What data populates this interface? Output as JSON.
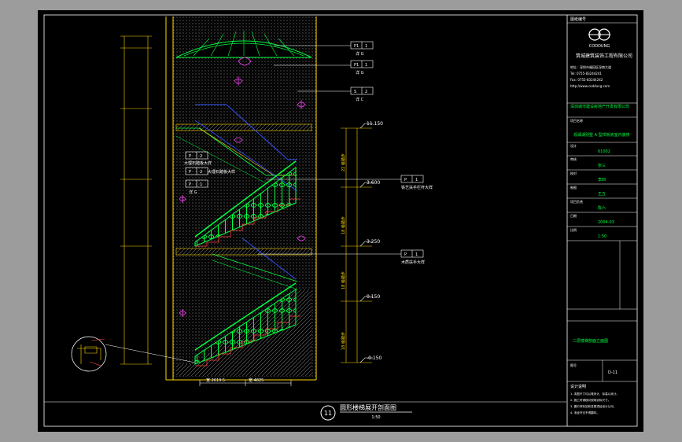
{
  "drawing_title": "圆形楼梯展开剖面图",
  "drawing_scale": "1:50",
  "detail_number": "11",
  "detail_tags": [
    {
      "number": "P1",
      "sheet": "1",
      "label": "详 G"
    },
    {
      "number": "P1",
      "sheet": "1",
      "label": "详 G"
    },
    {
      "number": "S",
      "sheet": "2",
      "label": "详 C"
    },
    {
      "number": "P",
      "sheet": "2",
      "label": "大理石踏板大样"
    },
    {
      "number": "P",
      "sheet": "2",
      "label": "大理石踏板大样"
    },
    {
      "number": "P",
      "sheet": "1",
      "label": "详 G"
    },
    {
      "number": "P",
      "sheet": "1",
      "label": "铁艺扶手栏杆大样"
    },
    {
      "number": "P",
      "sheet": "1",
      "label": "木质扶手大样"
    }
  ],
  "levels": [
    "11.150",
    "3.600",
    "3.250",
    "0.150",
    "-0.150"
  ],
  "flight_notes": [
    "22 级踏步",
    "18 级踏步",
    "18 级踏步",
    "18 级踏步"
  ],
  "bottom_dims": [
    "宽 2619.5",
    "宽 4825"
  ],
  "title_block": {
    "top_label": "图纸编号",
    "company_name": "CODDUNG",
    "company_cn": "筑城建筑装饰工程有限公司",
    "company_info": [
      "地址：深圳市福田区深南大道",
      "Tel: 0755-83244241",
      "Fax: 0755-83244242",
      "http://www.coddung.com"
    ],
    "client": "深圳城市建设房地产开发有限公司",
    "project_label": "项目名称",
    "project": "观澜湖别墅 A 型样板房室内装修",
    "fields": [
      {
        "label": "设计",
        "value": "01002"
      },
      {
        "label": "审核",
        "value": "张三"
      },
      {
        "label": "校对",
        "value": "李四"
      },
      {
        "label": "制图",
        "value": "王五"
      },
      {
        "label": "项目负责",
        "value": "陈六"
      },
      {
        "label": "日期",
        "value": "2004-03"
      },
      {
        "label": "比例",
        "value": "1:50"
      }
    ],
    "sheet_title": "二层楼梯剖面立面图",
    "sheet_no_label": "图号",
    "sheet_no": "D-11",
    "notes_title": "设计说明",
    "notes": [
      "1. 本图尺寸均以毫米计，标高以米计。",
      "2. 施工时请核对现场实际尺寸。",
      "3. 图中材料如有变更须经设计认可。",
      "4. 未经许可不得翻印。"
    ]
  }
}
